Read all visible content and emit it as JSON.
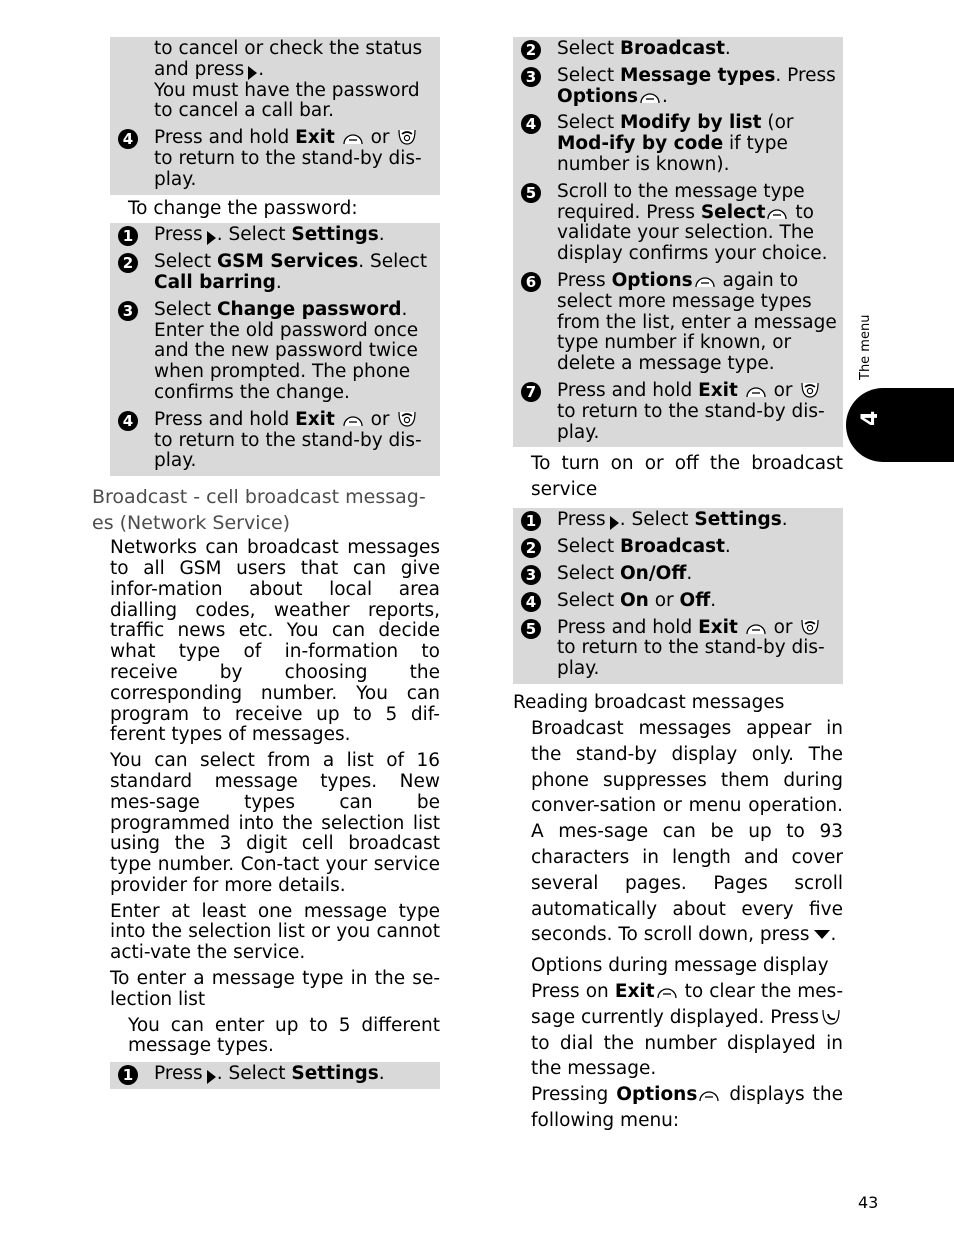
{
  "left": {
    "box1_cont": [
      "to cancel or check the status",
      "and press",
      "You must have the password to cancel a call bar."
    ],
    "step4a": {
      "num": "4",
      "pre": "Press and hold ",
      "bold": "Exit",
      "mid": " or ",
      "post": "to return to the stand-by dis-play."
    },
    "change_label": "To change the password:",
    "change_steps": [
      {
        "num": "1",
        "a": "Press",
        "b": ". Select ",
        "bold": "Settings",
        "c": "."
      },
      {
        "num": "2",
        "a": "Select ",
        "bold1": "GSM Services",
        "b": ". Select ",
        "bold2": "Call barring",
        "c": "."
      },
      {
        "num": "3",
        "a": "Select ",
        "bold": "Change password",
        "b": ". Enter the old password once and the new password twice when prompted. The phone confirms the change."
      },
      {
        "num": "4",
        "pre": "Press and hold ",
        "bold": "Exit",
        "mid": " or ",
        "post": "to return to the stand-by dis-play."
      }
    ],
    "heading": "Broadcast - cell broadcast messag-es (Network Service)",
    "paragraphs": [
      "Networks can broadcast messages to all GSM users that can give infor-mation about local area dialling codes, weather reports, traffic news etc. You can decide what type of in-formation to receive by choosing the corresponding number. You can program to receive up to 5 dif-ferent types of messages.",
      "You can select from a list of 16 standard message types. New mes-sage types can be programmed into the selection list using the 3 digit cell broadcast type number. Con-tact your service provider for more details.",
      "Enter at least one message type into the selection list or you cannot acti-vate the service.",
      "To enter a message type in the se-lection list"
    ],
    "enter_note": "You can enter up to 5 different message types.",
    "enter_step1": {
      "num": "1",
      "a": "Press",
      "b": ". Select ",
      "bold": "Settings",
      "c": "."
    }
  },
  "right": {
    "msg_steps": [
      {
        "num": "2",
        "a": "Select ",
        "bold": "Broadcast",
        "c": "."
      },
      {
        "num": "3",
        "a": "Select ",
        "bold1": "Message types",
        "b": ". Press ",
        "bold2": "Options",
        "c": "."
      },
      {
        "num": "4",
        "a": "Select ",
        "bold1": "Modify by list",
        "b": " (or ",
        "bold2": "Mod-ify by code",
        "c": " if type number is known)."
      },
      {
        "num": "5",
        "a": "Scroll to the message type required. Press ",
        "bold": "Select",
        "c": " to validate your selection. The display confirms your choice."
      },
      {
        "num": "6",
        "a": "Press ",
        "bold": "Options",
        "c": " again to select more message types from the list, enter a message type number if known, or delete a message type."
      },
      {
        "num": "7",
        "pre": "Press and hold ",
        "bold": "Exit",
        "mid": " or ",
        "post": "to return to the stand-by dis-play."
      }
    ],
    "onoff_label": "To turn on or off the broadcast service",
    "onoff_steps": [
      {
        "num": "1",
        "a": "Press",
        "b": ". Select ",
        "bold": "Settings",
        "c": "."
      },
      {
        "num": "2",
        "a": "Select ",
        "bold": "Broadcast",
        "c": "."
      },
      {
        "num": "3",
        "a": "Select ",
        "bold": "On/Off",
        "c": "."
      },
      {
        "num": "4",
        "a": "Select ",
        "bold1": "On",
        "b": " or ",
        "bold2": "Off",
        "c": "."
      },
      {
        "num": "5",
        "pre": "Press and hold ",
        "bold": "Exit",
        "mid": " or ",
        "post": "to return to the stand-by dis-play."
      }
    ],
    "reading_heading": "Reading broadcast messages",
    "reading_para": "Broadcast messages appear in the stand-by display only. The phone suppresses them during conver-sation or menu operation. A mes-sage can be up to 93 characters in length and cover several pages. Pages scroll automatically about every five seconds. To scroll down, press",
    "options_heading": "Options during message display",
    "exit_para": {
      "a": "Press on ",
      "bold": "Exit",
      "b": " to clear the mes-sage currently displayed. Press",
      "c": " to dial the number displayed in the message."
    },
    "options_para": {
      "a": "Pressing ",
      "bold": "Options",
      "b": " displays the following menu:"
    }
  },
  "side_tab": {
    "label": "The menu",
    "number": "4"
  },
  "page_number": "43"
}
